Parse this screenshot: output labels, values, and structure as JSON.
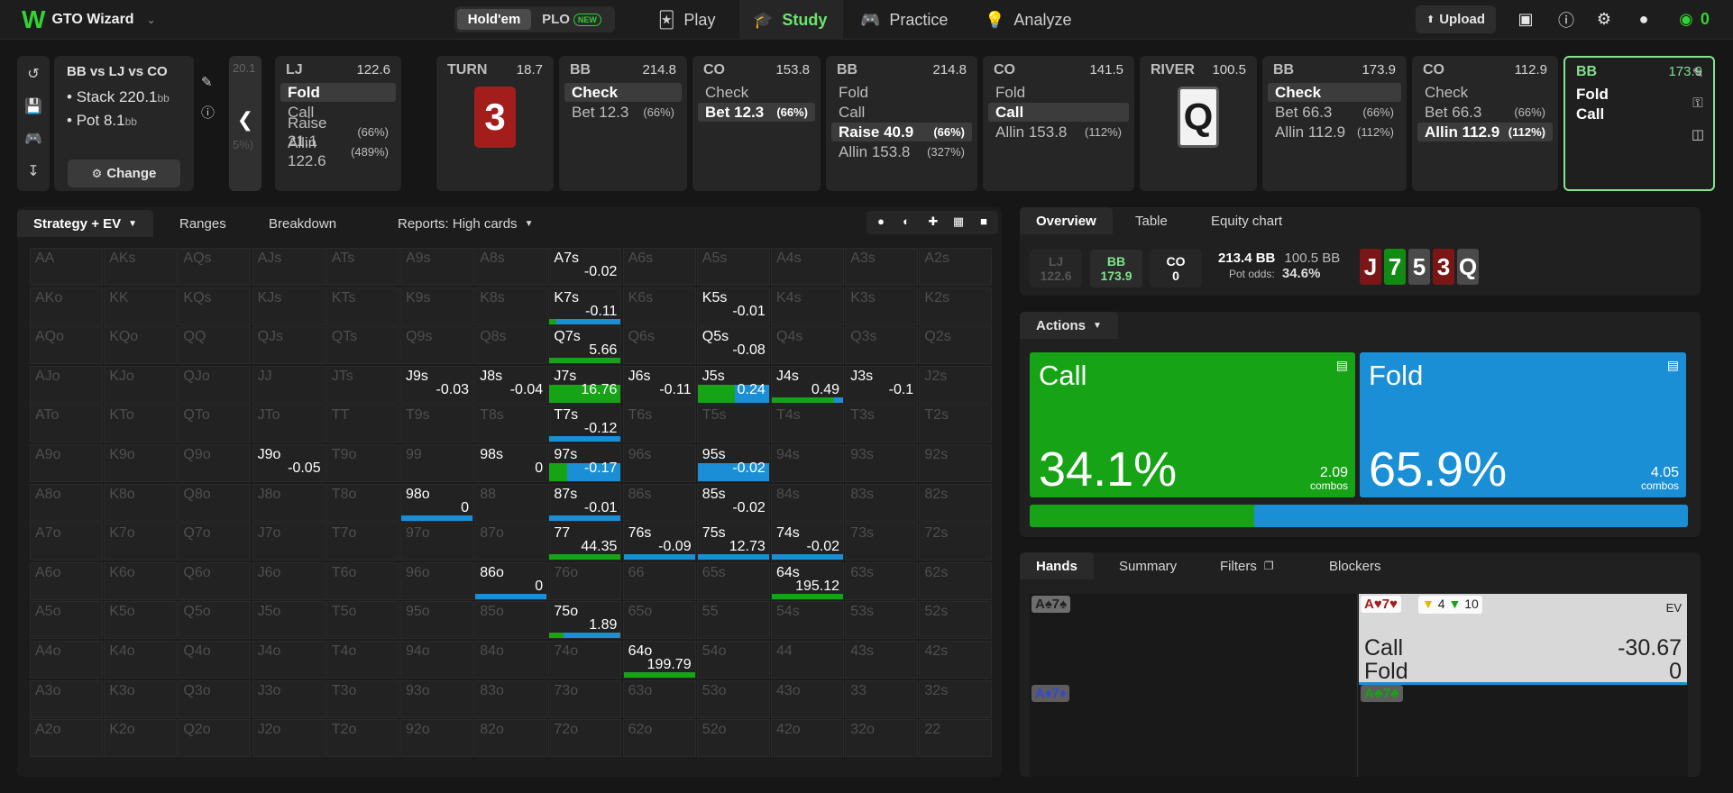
{
  "app": {
    "title": "GTO Wizard",
    "logo": "W"
  },
  "game_toggle": {
    "options": [
      "Hold'em",
      "PLO"
    ],
    "new_badge": "NEW"
  },
  "nav": [
    {
      "label": "Play",
      "icon": "cards-icon"
    },
    {
      "label": "Study",
      "icon": "graduation-cap-icon"
    },
    {
      "label": "Practice",
      "icon": "gamepad-icon"
    },
    {
      "label": "Analyze",
      "icon": "lightbulb-icon"
    }
  ],
  "topright": {
    "upload": "Upload",
    "balance": "0"
  },
  "spot": {
    "title": "BB vs LJ vs CO",
    "stack_label": "Stack",
    "stack": "220.1",
    "stack_unit": "bb",
    "pot_label": "Pot",
    "pot": "8.1",
    "pot_unit": "bb",
    "change": "Change"
  },
  "back_ghost": {
    "top": "20.1",
    "mid": "5%)"
  },
  "columns": [
    {
      "pos": "LJ",
      "stack": "122.6",
      "options": [
        {
          "l": "Fold",
          "sel": true
        },
        {
          "l": "Call"
        },
        {
          "l": "Raise 21.1",
          "p": "(66%)"
        },
        {
          "l": "Allin 122.6",
          "p": "(489%)"
        }
      ]
    },
    {
      "pos": "TURN",
      "stack": "18.7",
      "card": "3",
      "card_color": "#a31d1d"
    },
    {
      "pos": "BB",
      "stack": "214.8",
      "options": [
        {
          "l": "Check",
          "sel": true
        },
        {
          "l": "Bet 12.3",
          "p": "(66%)"
        }
      ]
    },
    {
      "pos": "CO",
      "stack": "153.8",
      "options": [
        {
          "l": "Check"
        },
        {
          "l": "Bet 12.3",
          "p": "(66%)",
          "sel": true
        }
      ]
    },
    {
      "pos": "BB",
      "stack": "214.8",
      "options": [
        {
          "l": "Fold"
        },
        {
          "l": "Call"
        },
        {
          "l": "Raise 40.9",
          "p": "(66%)",
          "sel": true
        },
        {
          "l": "Allin 153.8",
          "p": "(327%)"
        }
      ]
    },
    {
      "pos": "CO",
      "stack": "141.5",
      "options": [
        {
          "l": "Fold"
        },
        {
          "l": "Call",
          "sel": true
        },
        {
          "l": "Allin 153.8",
          "p": "(112%)"
        }
      ]
    },
    {
      "pos": "RIVER",
      "stack": "100.5",
      "card": "Q",
      "card_color": "#5a5a5a"
    },
    {
      "pos": "BB",
      "stack": "173.9",
      "options": [
        {
          "l": "Check",
          "sel": true
        },
        {
          "l": "Bet 66.3",
          "p": "(66%)"
        },
        {
          "l": "Allin 112.9",
          "p": "(112%)"
        }
      ]
    },
    {
      "pos": "CO",
      "stack": "112.9",
      "options": [
        {
          "l": "Check"
        },
        {
          "l": "Bet 66.3",
          "p": "(66%)"
        },
        {
          "l": "Allin 112.9",
          "p": "(112%)",
          "sel": true
        }
      ]
    },
    {
      "pos": "BB",
      "stack": "173.9",
      "options": [
        {
          "l": "Fold"
        },
        {
          "l": "Call"
        }
      ],
      "current": true
    }
  ],
  "left_tabs": [
    "Strategy + EV",
    "Ranges",
    "Breakdown",
    "Reports: High cards"
  ],
  "grid": {
    "rows": [
      [
        "AA",
        "AKs",
        "AQs",
        "AJs",
        "ATs",
        "A9s",
        "A8s",
        "A7s",
        "A6s",
        "A5s",
        "A4s",
        "A3s",
        "A2s"
      ],
      [
        "AKo",
        "KK",
        "KQs",
        "KJs",
        "KTs",
        "K9s",
        "K8s",
        "K7s",
        "K6s",
        "K5s",
        "K4s",
        "K3s",
        "K2s"
      ],
      [
        "AQo",
        "KQo",
        "QQ",
        "QJs",
        "QTs",
        "Q9s",
        "Q8s",
        "Q7s",
        "Q6s",
        "Q5s",
        "Q4s",
        "Q3s",
        "Q2s"
      ],
      [
        "AJo",
        "KJo",
        "QJo",
        "JJ",
        "JTs",
        "J9s",
        "J8s",
        "J7s",
        "J6s",
        "J5s",
        "J4s",
        "J3s",
        "J2s"
      ],
      [
        "ATo",
        "KTo",
        "QTo",
        "JTo",
        "TT",
        "T9s",
        "T8s",
        "T7s",
        "T6s",
        "T5s",
        "T4s",
        "T3s",
        "T2s"
      ],
      [
        "A9o",
        "K9o",
        "Q9o",
        "J9o",
        "T9o",
        "99",
        "98s",
        "97s",
        "96s",
        "95s",
        "94s",
        "93s",
        "92s"
      ],
      [
        "A8o",
        "K8o",
        "Q8o",
        "J8o",
        "T8o",
        "98o",
        "88",
        "87s",
        "86s",
        "85s",
        "84s",
        "83s",
        "82s"
      ],
      [
        "A7o",
        "K7o",
        "Q7o",
        "J7o",
        "T7o",
        "97o",
        "87o",
        "77",
        "76s",
        "75s",
        "74s",
        "73s",
        "72s"
      ],
      [
        "A6o",
        "K6o",
        "Q6o",
        "J6o",
        "T6o",
        "96o",
        "86o",
        "76o",
        "66",
        "65s",
        "64s",
        "63s",
        "62s"
      ],
      [
        "A5o",
        "K5o",
        "Q5o",
        "J5o",
        "T5o",
        "95o",
        "85o",
        "75o",
        "65o",
        "55",
        "54s",
        "53s",
        "52s"
      ],
      [
        "A4o",
        "K4o",
        "Q4o",
        "J4o",
        "T4o",
        "94o",
        "84o",
        "74o",
        "64o",
        "54o",
        "44",
        "43s",
        "42s"
      ],
      [
        "A3o",
        "K3o",
        "Q3o",
        "J3o",
        "T3o",
        "93o",
        "83o",
        "73o",
        "63o",
        "53o",
        "43o",
        "33",
        "32s"
      ],
      [
        "A2o",
        "K2o",
        "Q2o",
        "J2o",
        "T2o",
        "92o",
        "82o",
        "72o",
        "62o",
        "52o",
        "42o",
        "32o",
        "22"
      ]
    ],
    "active": [
      {
        "h": "A7s",
        "ev": "-0.02",
        "call": 0,
        "fold": 0
      },
      {
        "h": "K7s",
        "ev": "-0.11",
        "call": 0.1,
        "fold": 0.9
      },
      {
        "h": "K5s",
        "ev": "-0.01",
        "call": 0,
        "fold": 0
      },
      {
        "h": "Q7s",
        "ev": "5.66",
        "call": 1,
        "fold": 0
      },
      {
        "h": "Q5s",
        "ev": "-0.08",
        "call": 0,
        "fold": 0
      },
      {
        "h": "J9s",
        "ev": "-0.03",
        "call": 0,
        "fold": 0
      },
      {
        "h": "J8s",
        "ev": "-0.04",
        "call": 0,
        "fold": 0
      },
      {
        "h": "J7s",
        "ev": "16.76",
        "call": 1,
        "fold": 0,
        "big": 1
      },
      {
        "h": "J6s",
        "ev": "-0.11",
        "call": 0,
        "fold": 0
      },
      {
        "h": "J5s",
        "ev": "0.24",
        "call": 0.5,
        "fold": 0.5,
        "big": 1
      },
      {
        "h": "J4s",
        "ev": "0.49",
        "call": 0.85,
        "fold": 0.15
      },
      {
        "h": "J3s",
        "ev": "-0.1",
        "call": 0,
        "fold": 0
      },
      {
        "h": "T7s",
        "ev": "-0.12",
        "call": 0,
        "fold": 1
      },
      {
        "h": "J9o",
        "ev": "-0.05",
        "call": 0,
        "fold": 0
      },
      {
        "h": "98s",
        "ev": "0",
        "call": 0,
        "fold": 0
      },
      {
        "h": "97s",
        "ev": "-0.17",
        "call": 0.25,
        "fold": 0.75,
        "big": 1
      },
      {
        "h": "95s",
        "ev": "-0.02",
        "call": 0,
        "fold": 1,
        "big": 1
      },
      {
        "h": "98o",
        "ev": "0",
        "call": 0,
        "fold": 1
      },
      {
        "h": "87s",
        "ev": "-0.01",
        "call": 0,
        "fold": 1
      },
      {
        "h": "85s",
        "ev": "-0.02",
        "call": 0,
        "fold": 0
      },
      {
        "h": "77",
        "ev": "44.35",
        "call": 1,
        "fold": 0
      },
      {
        "h": "76s",
        "ev": "-0.09",
        "call": 0,
        "fold": 1
      },
      {
        "h": "75s",
        "ev": "12.73",
        "call": 0,
        "fold": 1
      },
      {
        "h": "74s",
        "ev": "-0.02",
        "call": 0,
        "fold": 1
      },
      {
        "h": "86o",
        "ev": "0",
        "call": 0,
        "fold": 1
      },
      {
        "h": "64s",
        "ev": "195.12",
        "call": 1,
        "fold": 0
      },
      {
        "h": "75o",
        "ev": "1.89",
        "call": 0.2,
        "fold": 0.8
      },
      {
        "h": "64o",
        "ev": "199.79",
        "call": 1,
        "fold": 0
      }
    ]
  },
  "overview": {
    "tabs": [
      "Overview",
      "Table",
      "Equity chart"
    ],
    "chips": [
      {
        "pos": "LJ",
        "val": "122.6"
      },
      {
        "pos": "BB",
        "val": "173.9"
      },
      {
        "pos": "CO",
        "val": "0"
      }
    ],
    "pot": "213.4 BB",
    "pot2": "100.5 BB",
    "pot_odds_label": "Pot odds:",
    "pot_odds": "34.6%",
    "board": [
      {
        "r": "J",
        "c": "#7a1616"
      },
      {
        "r": "7",
        "c": "#138a13"
      },
      {
        "r": "5",
        "c": "#4a4a4a"
      },
      {
        "r": "3",
        "c": "#7a1616"
      },
      {
        "r": "Q",
        "c": "#4a4a4a"
      }
    ]
  },
  "actions": {
    "label": "Actions",
    "items": [
      {
        "name": "Call",
        "pct": "34.1%",
        "combos": "2.09",
        "combos_label": "combos",
        "color": "#16a316",
        "frac": 0.341
      },
      {
        "name": "Fold",
        "pct": "65.9%",
        "combos": "4.05",
        "combos_label": "combos",
        "color": "#1a8fd6",
        "frac": 0.659
      }
    ]
  },
  "hands": {
    "tabs": [
      "Hands",
      "Summary",
      "Filters",
      "Blockers"
    ],
    "left": [
      "A♠7♠",
      "A♦7♦"
    ],
    "right": [
      "A♥7♥",
      "A♣7♣"
    ],
    "badge_a": "4",
    "badge_b": "10",
    "ev_label": "EV",
    "rows": [
      {
        "a": "Call",
        "v": "-30.67"
      },
      {
        "a": "Fold",
        "v": "0"
      }
    ]
  }
}
